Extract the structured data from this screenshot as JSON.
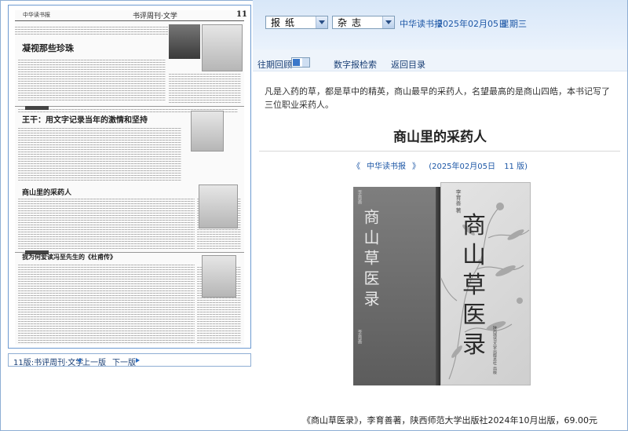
{
  "top": {
    "paper_select": "报纸",
    "magazine_select": "杂志",
    "paper_name": "中华读书报",
    "date": "2025年02月05日",
    "weekday": "星期三"
  },
  "nav": {
    "past_label": "往期回顾",
    "search_label": "数字报检索",
    "home_label": "返回目录"
  },
  "article": {
    "lead": "凡是入药的草，都是草中的精英，商山最早的采药人，名望最高的是商山四皓，本书记写了三位职业采药人。",
    "title": "商山里的采药人",
    "source": {
      "open": "《",
      "paper": "中华读书报",
      "close": "》",
      "date": "(2025年02月05日",
      "page": "11 版)"
    },
    "caption": "《商山草医录》，李育善著，陕西师范大学出版社2024年10月出版，69.00元"
  },
  "book_cover": {
    "title_chars": [
      "商",
      "山",
      "草",
      "医",
      "录"
    ],
    "spine_title": "商山草医录",
    "author": "李育善 著",
    "spine_author": "李育善",
    "publisher": "陕西师范大学出版总社 出版"
  },
  "thumbnail": {
    "masthead": "中华读书报",
    "section": "书评周刊·文学",
    "page_number": "11",
    "headlines": [
      "凝视那些珍珠",
      "王干：用文字记录当年的激情和坚持",
      "商山里的采药人",
      "我为何爱读冯至先生的《杜甫传》"
    ]
  },
  "pager": {
    "label": "11版:书评周刊·文学",
    "prev": "上一版",
    "next": "下一版"
  }
}
